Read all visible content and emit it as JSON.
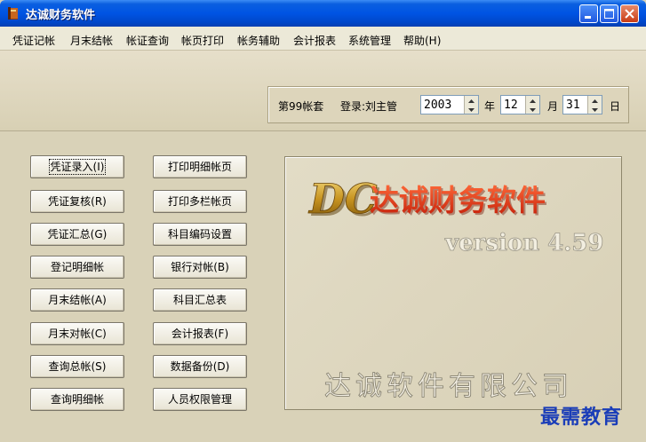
{
  "window": {
    "title": "达诚财务软件"
  },
  "menu": [
    "凭证记帐",
    "月末结帐",
    "帐证查询",
    "帐页打印",
    "帐务辅助",
    "会计报表",
    "系统管理",
    "帮助(H)"
  ],
  "session": {
    "book_label": "第99帐套",
    "login_label": "登录:刘主管",
    "year": "2003",
    "year_unit": "年",
    "month": "12",
    "month_unit": "月",
    "day": "31",
    "day_unit": "日"
  },
  "buttons_left": [
    "凭证录入(I)",
    "凭证复核(R)",
    "凭证汇总(G)",
    "登记明细帐",
    "月末结帐(A)",
    "月末对帐(C)",
    "查询总帐(S)",
    "查询明细帐"
  ],
  "buttons_right": [
    "打印明细帐页",
    "打印多栏帐页",
    "科目编码设置",
    "银行对帐(B)",
    "科目汇总表",
    "会计报表(F)",
    "数据备份(D)",
    "人员权限管理"
  ],
  "splash": {
    "logo_letters": "DC",
    "product_name": "达诚财务软件",
    "version": "version 4.59",
    "company": "达诚软件有限公司"
  },
  "watermark": "最需教育",
  "colors": {
    "title_bar": "#0054e3",
    "logo_red": "#e03a1c",
    "logo_gold": "#d4a838"
  }
}
